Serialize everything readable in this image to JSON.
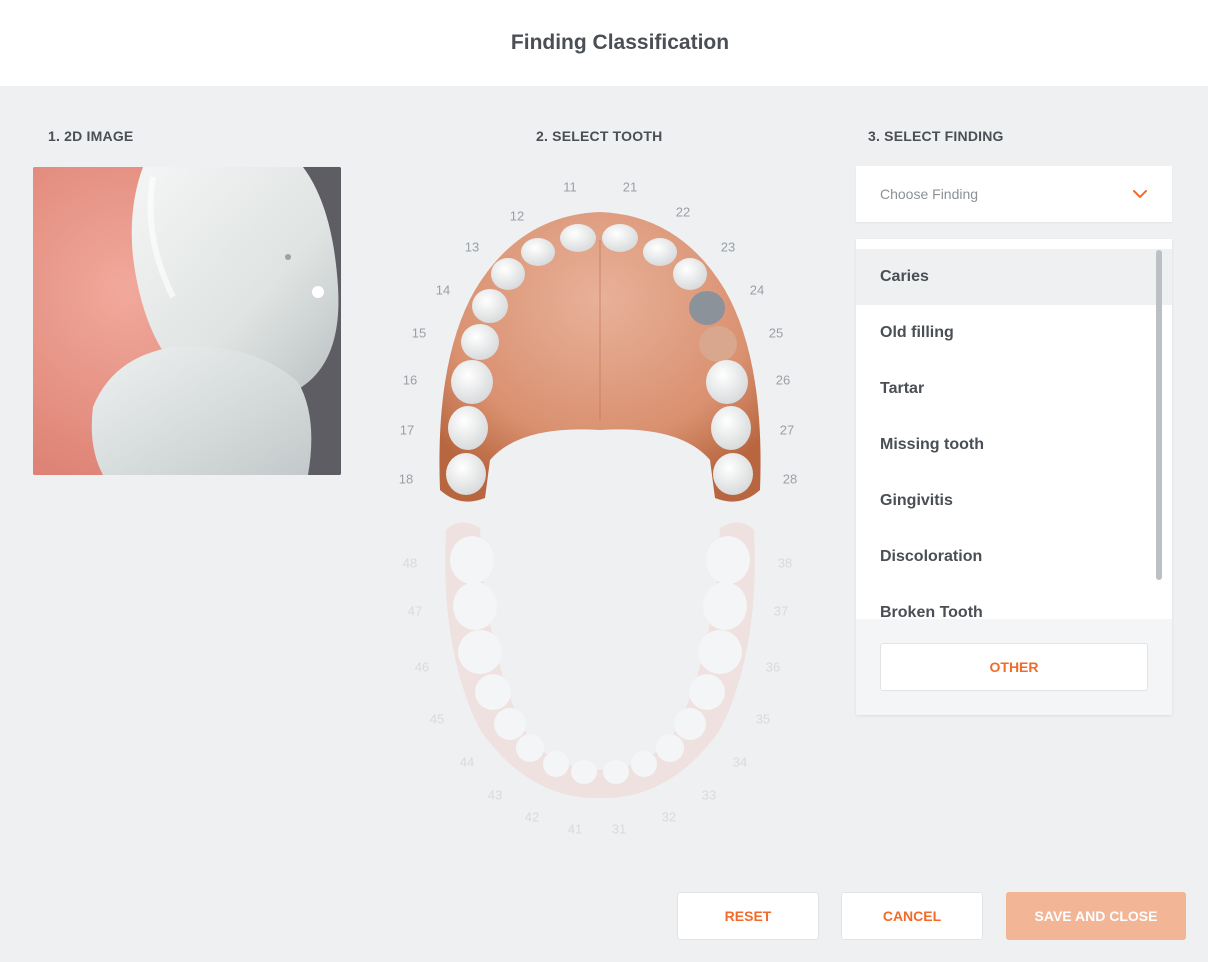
{
  "header": {
    "title": "Finding Classification"
  },
  "sections": {
    "image_title": "1. 2D IMAGE",
    "tooth_title": "2. SELECT TOOTH",
    "finding_title": "3. SELECT FINDING"
  },
  "finding_select": {
    "placeholder": "Choose Finding"
  },
  "findings": {
    "items": [
      {
        "label": "Caries"
      },
      {
        "label": "Old filling"
      },
      {
        "label": "Tartar"
      },
      {
        "label": "Missing tooth"
      },
      {
        "label": "Gingivitis"
      },
      {
        "label": "Discoloration"
      },
      {
        "label": "Broken Tooth"
      }
    ]
  },
  "buttons": {
    "other": "OTHER",
    "reset": "RESET",
    "cancel": "CANCEL",
    "save": "SAVE AND CLOSE"
  },
  "teeth": {
    "upper": [
      "11",
      "21",
      "12",
      "22",
      "13",
      "23",
      "14",
      "24",
      "15",
      "25",
      "16",
      "26",
      "17",
      "27",
      "18",
      "28"
    ],
    "lower": [
      "48",
      "38",
      "47",
      "37",
      "46",
      "36",
      "45",
      "35",
      "44",
      "34",
      "43",
      "33",
      "42",
      "32",
      "41",
      "31"
    ]
  },
  "colors": {
    "accent": "#f26b2a",
    "save_disabled": "#f2b595",
    "background": "#eff0f2"
  }
}
